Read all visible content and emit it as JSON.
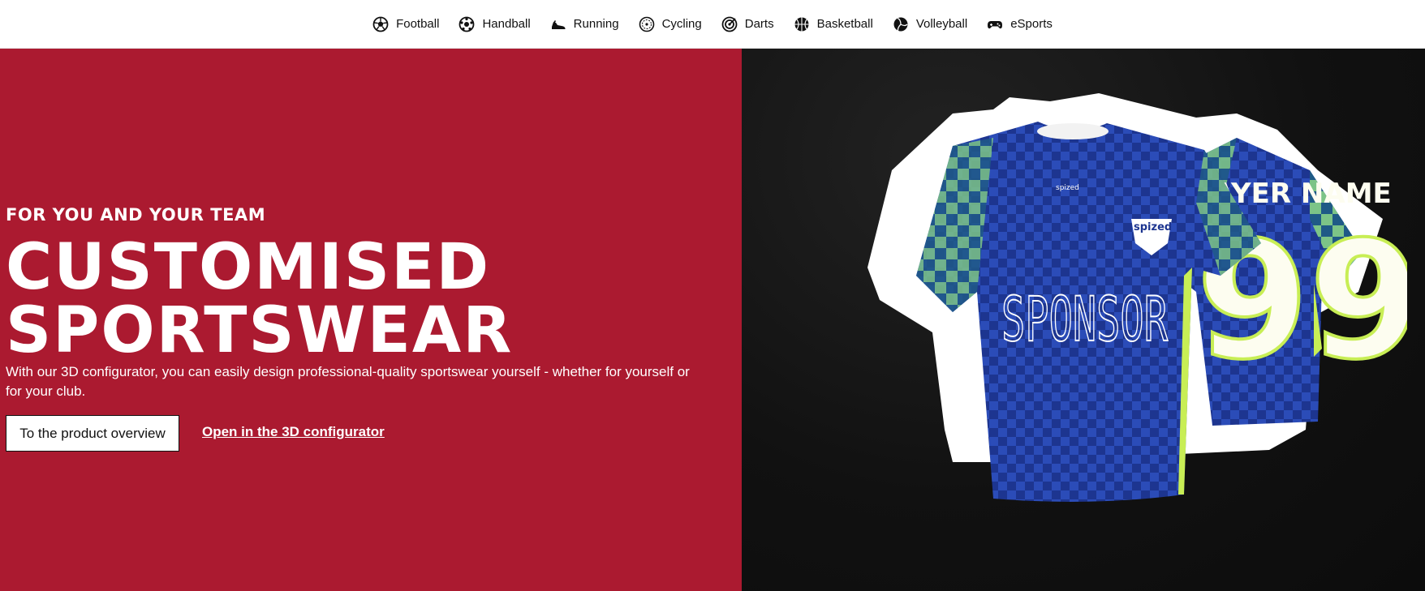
{
  "nav": {
    "items": [
      {
        "label": "Football",
        "icon": "football-icon"
      },
      {
        "label": "Handball",
        "icon": "handball-icon"
      },
      {
        "label": "Running",
        "icon": "running-shoe-icon"
      },
      {
        "label": "Cycling",
        "icon": "cycling-wheel-icon"
      },
      {
        "label": "Darts",
        "icon": "darts-target-icon"
      },
      {
        "label": "Basketball",
        "icon": "basketball-icon"
      },
      {
        "label": "Volleyball",
        "icon": "volleyball-icon"
      },
      {
        "label": "eSports",
        "icon": "gamepad-icon"
      }
    ]
  },
  "hero": {
    "eyebrow": "FOR YOU AND YOUR TEAM",
    "headline_line1": "CUSTOMISED",
    "headline_line2": "SPORTSWEAR",
    "description": "With our 3D configurator, you can easily design professional-quality sportswear yourself - whether for yourself or for your club.",
    "primary_button": "To the product overview",
    "secondary_link": "Open in the 3D configurator"
  },
  "image": {
    "front_brand": "spized",
    "front_crest": "spized",
    "front_sponsor": "SPONSOR",
    "back_name": "AYER NAME",
    "back_number": "99"
  },
  "colors": {
    "hero_red": "#ab1a30",
    "dark_bg": "#111111",
    "jersey_blue": "#1d3590",
    "jersey_accent_green": "#a8d86a"
  }
}
